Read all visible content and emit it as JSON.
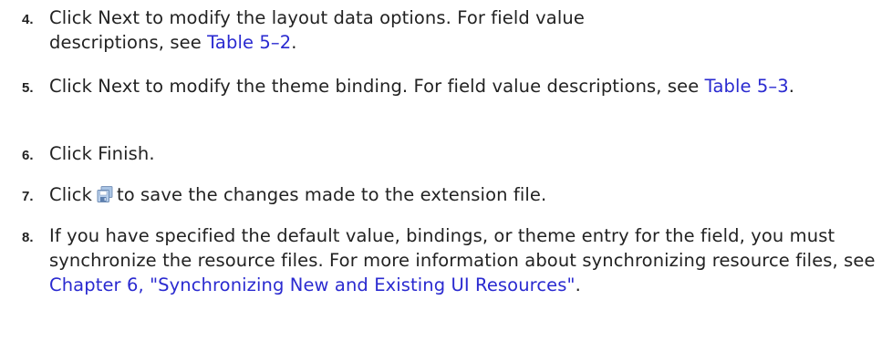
{
  "steps": [
    {
      "number": "4.",
      "before": "Click Next to modify the layout data options. For field value descriptions, see ",
      "link": "Table 5–2",
      "after": "."
    },
    {
      "number": "5.",
      "before": "Click Next to modify the theme binding. For field value descriptions, see ",
      "link": "Table 5–3",
      "after": "."
    },
    {
      "number": "6.",
      "text": "Click Finish."
    },
    {
      "number": "7.",
      "before": "Click",
      "icon": "save-all-icon",
      "after": "to save the changes made to the extension file."
    },
    {
      "number": "8.",
      "before": "If you have specified the default value, bindings, or theme entry for the field, you must synchronize the resource files. For more information about synchronizing resource files, see ",
      "link": "Chapter 6, \"Synchronizing New and Existing UI Resources\"",
      "after": "."
    }
  ],
  "colors": {
    "text": "#222222",
    "link": "#2a2ad0"
  }
}
